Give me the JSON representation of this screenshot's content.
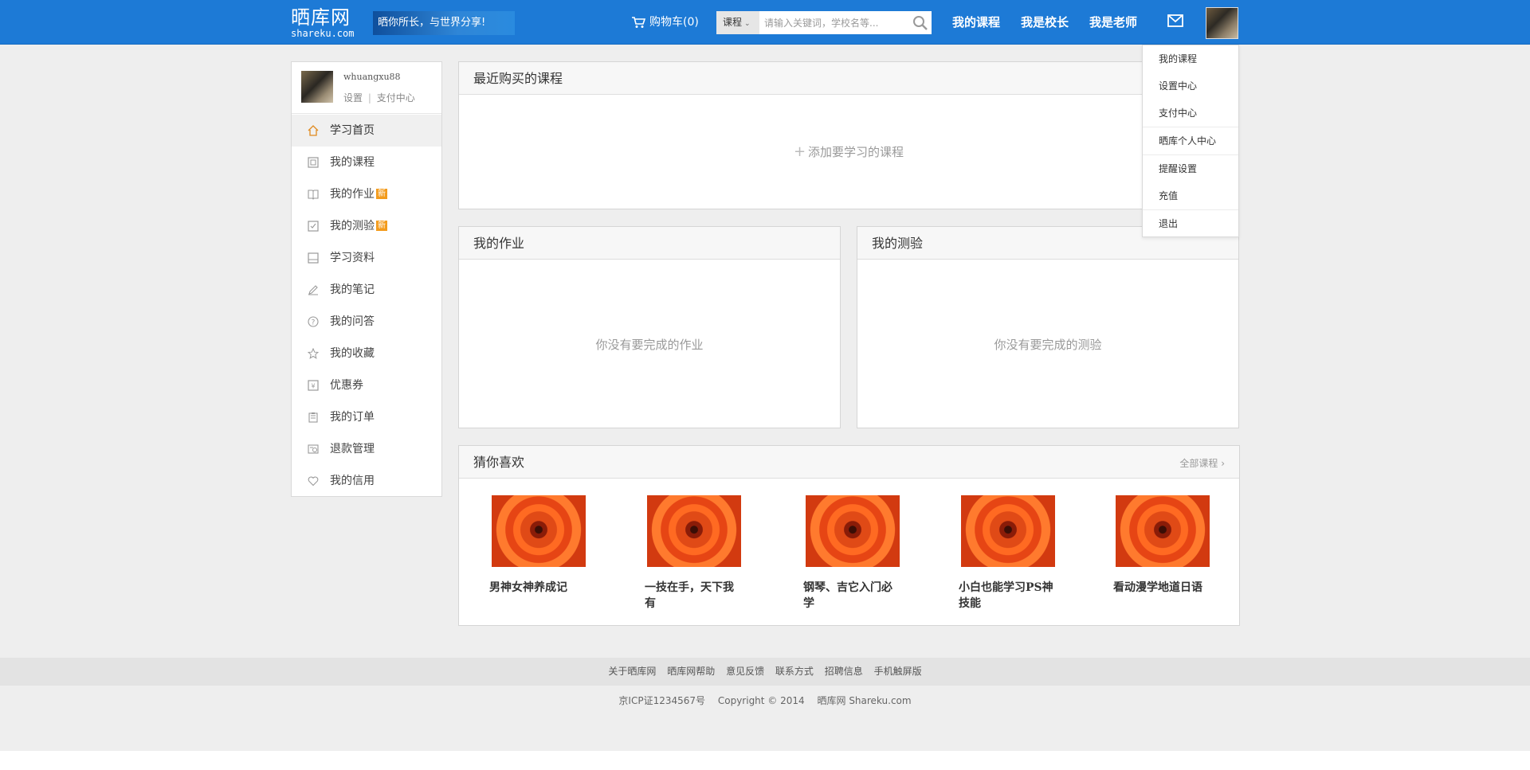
{
  "header": {
    "logo_main": "晒库网",
    "logo_sub": "shareku.com",
    "logo_slogan": "晒你所长，与世界分享!",
    "cart_label": "购物车(0)",
    "search_category": "课程",
    "search_placeholder": "请输入关键词，学校名等...",
    "nav": [
      "我的课程",
      "我是校长",
      "我是老师"
    ]
  },
  "dropdown": {
    "items": [
      "我的课程",
      "设置中心",
      "支付中心",
      "晒库个人中心",
      "提醒设置",
      "充值",
      "退出"
    ]
  },
  "sidebar": {
    "username": "whuangxu88",
    "settings_link": "设置",
    "divider": "|",
    "pay_link": "支付中心",
    "badge": "新",
    "items": [
      {
        "label": "学习首页",
        "icon": "home-icon"
      },
      {
        "label": "我的课程",
        "icon": "course-icon"
      },
      {
        "label": "我的作业",
        "icon": "homework-icon"
      },
      {
        "label": "我的测验",
        "icon": "quiz-icon"
      },
      {
        "label": "学习资料",
        "icon": "materials-icon"
      },
      {
        "label": "我的笔记",
        "icon": "pen-icon"
      },
      {
        "label": "我的问答",
        "icon": "question-icon"
      },
      {
        "label": "我的收藏",
        "icon": "star-icon"
      },
      {
        "label": "优惠券",
        "icon": "coupon-icon"
      },
      {
        "label": "我的订单",
        "icon": "order-icon"
      },
      {
        "label": "退款管理",
        "icon": "refund-icon"
      },
      {
        "label": "我的信用",
        "icon": "heart-icon"
      }
    ]
  },
  "recent": {
    "title": "最近购买的课程",
    "add_label": "添加要学习的课程"
  },
  "homework": {
    "title": "我的作业",
    "empty": "你没有要完成的作业"
  },
  "quiz": {
    "title": "我的测验",
    "empty": "你没有要完成的测验"
  },
  "recommend": {
    "title": "猜你喜欢",
    "all_label": "全部课程",
    "courses": [
      "男神女神养成记",
      "一技在手，天下我有",
      "钢琴、吉它入门必学",
      "小白也能学习PS神技能",
      "看动漫学地道日语"
    ]
  },
  "footer": {
    "links": [
      "关于晒库网",
      "晒库网帮助",
      "意见反馈",
      "联系方式",
      "招聘信息",
      "手机触屏版"
    ],
    "icp": "京ICP证1234567号",
    "copyright": "Copyright © 2014",
    "site": "晒库网 Shareku.com"
  }
}
